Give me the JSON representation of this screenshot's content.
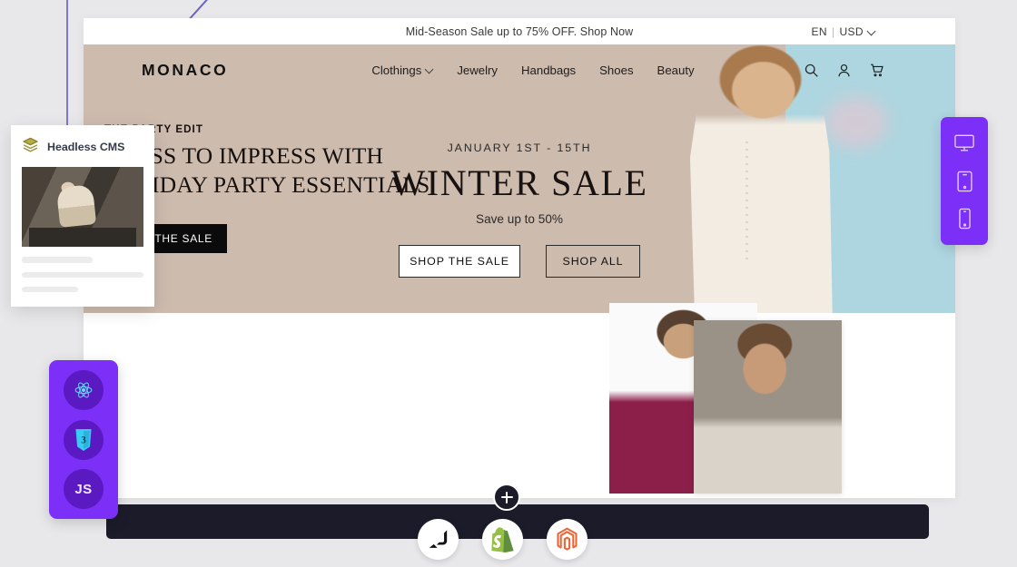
{
  "decor": {
    "vline_color": "#7b78d0",
    "accent_purple": "#7b2ff7",
    "bar_color": "#1b1b2a",
    "page_bg": "#e8e8ea"
  },
  "site": {
    "announcement": {
      "text": "Mid-Season Sale up to 75% OFF. Shop Now"
    },
    "locale": {
      "language": "EN",
      "divider": "|",
      "currency": "USD",
      "chevron_icon": "chevron-down-icon"
    },
    "nav": {
      "brand": "MONACO",
      "links": [
        {
          "label": "Clothings",
          "has_dropdown": true
        },
        {
          "label": "Jewelry",
          "has_dropdown": false
        },
        {
          "label": "Handbags",
          "has_dropdown": false
        },
        {
          "label": "Shoes",
          "has_dropdown": false
        },
        {
          "label": "Beauty",
          "has_dropdown": false
        }
      ],
      "icons": [
        "search-icon",
        "user-account-icon",
        "shopping-cart-icon"
      ]
    },
    "hero": {
      "kicker": "JANUARY 1ST - 15TH",
      "title": "WINTER SALE",
      "subtitle": "Save up to 50%",
      "primary_button": "SHOP THE SALE",
      "secondary_button": "SHOP ALL",
      "bg_left_color": "#cdbbae",
      "bg_right_color": "#aed6e0"
    },
    "editorial": {
      "kicker": "THE PARTY EDIT",
      "headline": "DRESS TO IMPRESS WITH HOLIDAY PARTY ESSENTIALS.",
      "button": "SHOP THE SALE"
    }
  },
  "cms_card": {
    "icon": "layers-stack-icon",
    "title": "Headless CMS",
    "photo_alt": "fashion model seated outdoors",
    "skeleton_lines": 3
  },
  "tech_rail": {
    "items": [
      {
        "name": "react-icon",
        "label": "React"
      },
      {
        "name": "css3-icon",
        "label": "CSS3"
      },
      {
        "name": "javascript-icon",
        "label": "JS"
      }
    ]
  },
  "device_rail": {
    "items": [
      {
        "name": "desktop-icon",
        "label": "Desktop"
      },
      {
        "name": "tablet-icon",
        "label": "Tablet"
      },
      {
        "name": "mobile-icon",
        "label": "Mobile"
      }
    ]
  },
  "platform_bar": {
    "add_button": {
      "icon": "plus-icon",
      "label": "Add"
    },
    "logos": [
      {
        "name": "bigcommerce-logo",
        "label": "BigCommerce"
      },
      {
        "name": "shopify-logo",
        "label": "Shopify"
      },
      {
        "name": "magento-logo",
        "label": "Magento"
      }
    ]
  }
}
